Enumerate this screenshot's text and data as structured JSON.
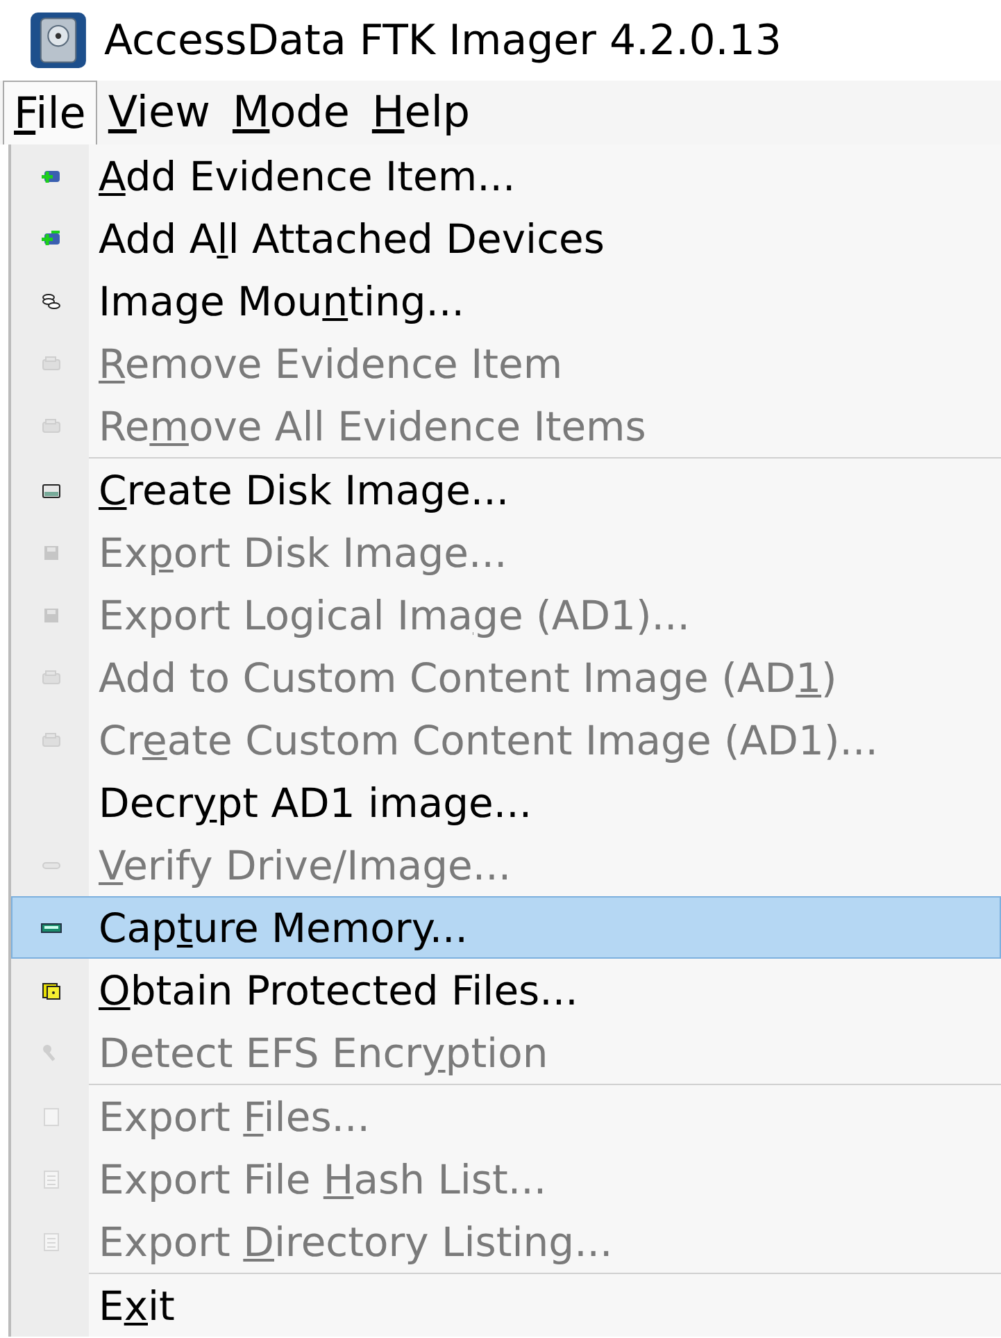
{
  "window": {
    "title": "AccessData FTK Imager 4.2.0.13"
  },
  "menu_bar": [
    {
      "label": {
        "key": "F",
        "after": "ile"
      },
      "selected": true
    },
    {
      "label": {
        "key": "V",
        "after": "iew"
      },
      "selected": false
    },
    {
      "label": {
        "key": "M",
        "after": "ode"
      },
      "selected": false
    },
    {
      "label": {
        "key": "H",
        "after": "elp"
      },
      "selected": false
    }
  ],
  "file_menu": [
    {
      "kind": "item",
      "label": {
        "key": "A",
        "after": "dd Evidence Item..."
      },
      "disabled": false,
      "selected": false
    },
    {
      "kind": "item",
      "label": {
        "before": "Add A",
        "key": "l",
        "after": "l Attached Devices"
      },
      "disabled": false,
      "selected": false
    },
    {
      "kind": "item",
      "label": {
        "before": "Image Mou",
        "key": "n",
        "after": "ting..."
      },
      "disabled": false,
      "selected": false
    },
    {
      "kind": "item",
      "label": {
        "key": "R",
        "after": "emove Evidence Item"
      },
      "disabled": true,
      "selected": false
    },
    {
      "kind": "item",
      "label": {
        "before": "Re",
        "key": "m",
        "after": "ove All Evidence Items"
      },
      "disabled": true,
      "selected": false
    },
    {
      "kind": "separator"
    },
    {
      "kind": "item",
      "label": {
        "key": "C",
        "after": "reate Disk Image..."
      },
      "disabled": false,
      "selected": false
    },
    {
      "kind": "item",
      "label": {
        "before": "Ex",
        "key": "p",
        "after": "ort Disk Image..."
      },
      "disabled": true,
      "selected": false
    },
    {
      "kind": "item",
      "label": {
        "before": "Export Logical Ima",
        "key": "g",
        "after": "e (AD1)..."
      },
      "disabled": true,
      "selected": false
    },
    {
      "kind": "item",
      "label": {
        "before": "Add to Custom Content Image (AD",
        "key": "1",
        "after": ")"
      },
      "disabled": true,
      "selected": false
    },
    {
      "kind": "item",
      "label": {
        "before": "Cr",
        "key": "e",
        "after": "ate Custom Content Image (AD1)..."
      },
      "disabled": true,
      "selected": false
    },
    {
      "kind": "item",
      "label": {
        "before": "Decr",
        "key": "y",
        "after": "pt AD1 image..."
      },
      "disabled": false,
      "selected": false
    },
    {
      "kind": "item",
      "label": {
        "key": "V",
        "after": "erify Drive/Image..."
      },
      "disabled": true,
      "selected": false
    },
    {
      "kind": "item",
      "label": {
        "before": "Cap",
        "key": "t",
        "after": "ure Memory..."
      },
      "disabled": false,
      "selected": true
    },
    {
      "kind": "item",
      "label": {
        "key": "O",
        "after": "btain Protected Files..."
      },
      "disabled": false,
      "selected": false
    },
    {
      "kind": "item",
      "label": {
        "before": "Detect EFS Encr",
        "key": "y",
        "after": "ption"
      },
      "disabled": true,
      "selected": false
    },
    {
      "kind": "separator"
    },
    {
      "kind": "item",
      "label": {
        "before": "Export ",
        "key": "F",
        "after": "iles..."
      },
      "disabled": true,
      "selected": false
    },
    {
      "kind": "item",
      "label": {
        "before": "Export File ",
        "key": "H",
        "after": "ash List..."
      },
      "disabled": true,
      "selected": false
    },
    {
      "kind": "item",
      "label": {
        "before": "Export ",
        "key": "D",
        "after": "irectory Listing..."
      },
      "disabled": true,
      "selected": false
    },
    {
      "kind": "separator"
    },
    {
      "kind": "item",
      "label": {
        "before": "E",
        "key": "x",
        "after": "it"
      },
      "disabled": false,
      "selected": false
    }
  ]
}
